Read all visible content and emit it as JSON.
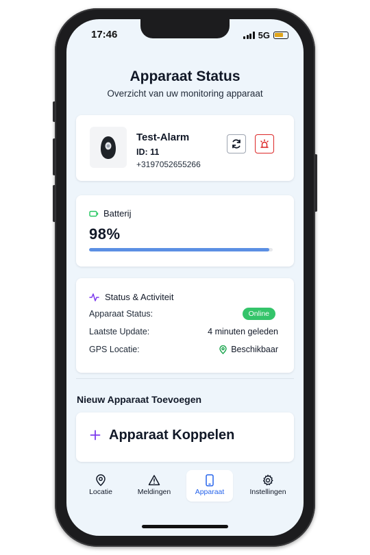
{
  "status_bar": {
    "time": "17:46",
    "network": "5G"
  },
  "header": {
    "title": "Apparaat Status",
    "subtitle": "Overzicht van uw monitoring apparaat"
  },
  "device": {
    "name": "Test-Alarm",
    "id_label": "ID: 11",
    "phone": "+3197052655266",
    "icons": {
      "image": "alarm-device-icon",
      "refresh": "refresh-icon",
      "alarm": "alarm-icon"
    }
  },
  "battery": {
    "label": "Batterij",
    "value_text": "98%",
    "level_percent": 98,
    "bar_color": "#5b8fe3"
  },
  "status": {
    "heading": "Status & Activiteit",
    "rows": [
      {
        "label": "Apparaat Status:",
        "value": "Online"
      },
      {
        "label": "Laatste Update:",
        "value": "4 minuten geleden"
      },
      {
        "label": "GPS Locatie:",
        "value": "Beschikbaar"
      }
    ],
    "online_color": "#34c46a"
  },
  "new_device": {
    "heading": "Nieuw Apparaat Toevoegen",
    "button_label": "Apparaat Koppelen"
  },
  "nav": {
    "items": [
      {
        "label": "Locatie",
        "icon": "map-pin-icon"
      },
      {
        "label": "Meldingen",
        "icon": "warning-icon"
      },
      {
        "label": "Apparaat",
        "icon": "smartphone-icon",
        "active": true
      },
      {
        "label": "Instellingen",
        "icon": "gear-icon"
      }
    ],
    "active_color": "#2563eb"
  }
}
